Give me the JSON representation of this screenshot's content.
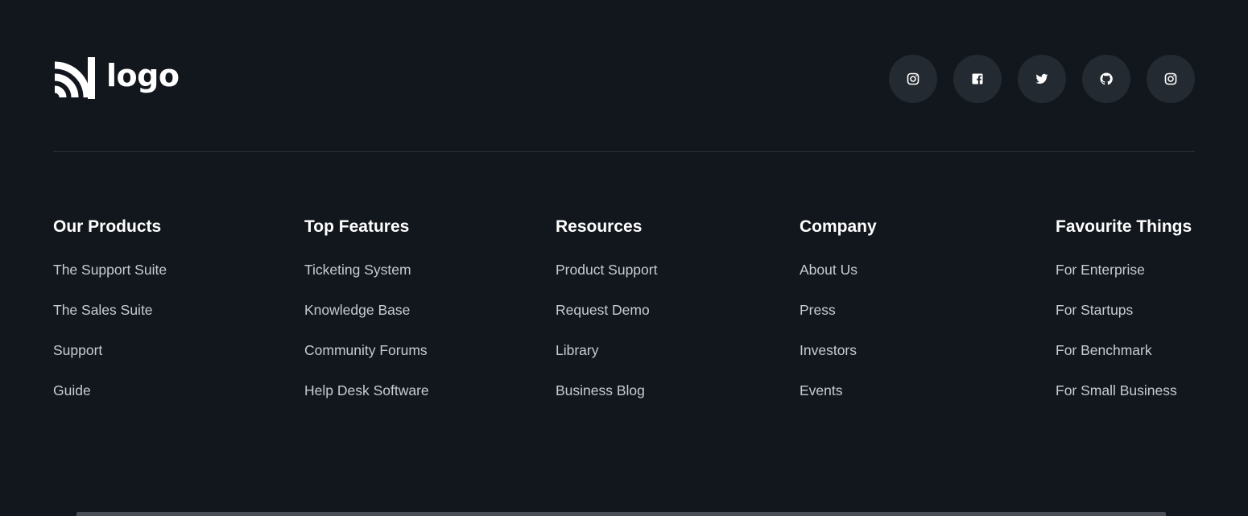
{
  "brand": {
    "logo_text": "logo"
  },
  "socials": [
    {
      "icon": "instagram-icon"
    },
    {
      "icon": "facebook-icon"
    },
    {
      "icon": "twitter-icon"
    },
    {
      "icon": "github-icon"
    },
    {
      "icon": "instagram-icon"
    }
  ],
  "columns": [
    {
      "heading": "Our Products",
      "links": [
        "The Support Suite",
        "The Sales Suite",
        "Support",
        "Guide"
      ]
    },
    {
      "heading": "Top Features",
      "links": [
        "Ticketing System",
        "Knowledge Base",
        "Community Forums",
        "Help Desk Software"
      ]
    },
    {
      "heading": "Resources",
      "links": [
        "Product Support",
        "Request Demo",
        "Library",
        "Business Blog"
      ]
    },
    {
      "heading": "Company",
      "links": [
        "About Us",
        "Press",
        "Investors",
        "Events"
      ]
    },
    {
      "heading": "Favourite Things",
      "links": [
        "For Enterprise",
        "For Startups",
        "For Benchmark",
        "For Small Business"
      ]
    }
  ],
  "colors": {
    "background": "#12171d",
    "social_button": "#232a31",
    "divider": "#2a323a",
    "link_text": "#c8ccd1",
    "heading_text": "#ffffff"
  }
}
